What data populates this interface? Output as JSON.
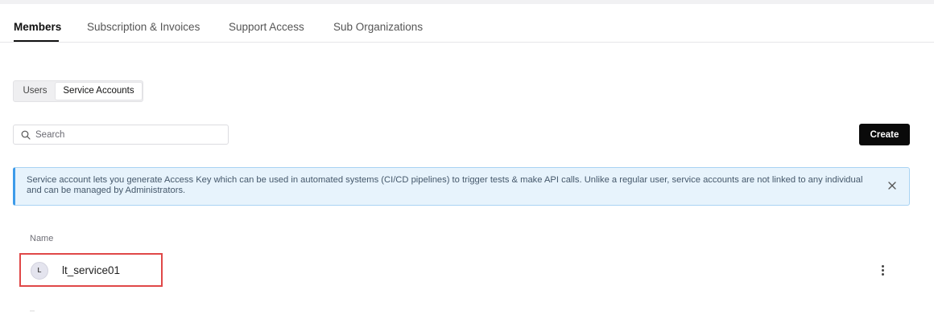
{
  "tabs": [
    {
      "label": "Members",
      "active": true
    },
    {
      "label": "Subscription & Invoices",
      "active": false
    },
    {
      "label": "Support Access",
      "active": false
    },
    {
      "label": "Sub Organizations",
      "active": false
    }
  ],
  "segmented": {
    "users_label": "Users",
    "service_label": "Service Accounts",
    "selected": "Service Accounts"
  },
  "search": {
    "placeholder": "Search",
    "value": "",
    "icon": "search-icon"
  },
  "create_label": "Create",
  "info_banner": {
    "text": "Service account lets you generate Access Key which can be used in automated systems (CI/CD pipelines) to trigger tests & make API calls. Unlike a regular user, service accounts are not linked to any individual and can be managed by Administrators.",
    "close_icon": "close-icon",
    "accent_color": "#3d9be9",
    "background_color": "#e7f3fc"
  },
  "table": {
    "column_header": "Name",
    "rows": [
      {
        "avatar_initial": "L",
        "name": "lt_service01",
        "highlighted": true,
        "actions_icon": "more-vertical-icon"
      }
    ]
  },
  "colors": {
    "highlight_border": "#e04848",
    "primary_button": "#0a0a0a"
  }
}
